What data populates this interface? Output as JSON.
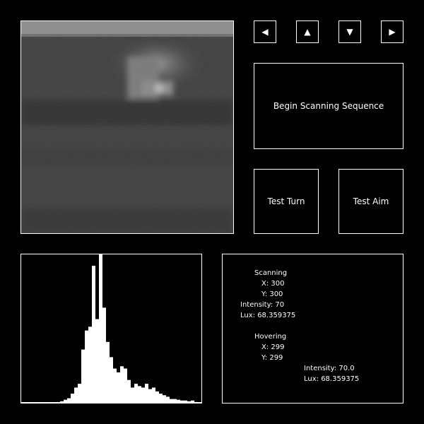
{
  "controls": {
    "left_icon": "◀",
    "up_icon": "▲",
    "down_icon": "▼",
    "right_icon": "▶",
    "scan_label": "Begin Scanning Sequence",
    "turn_label": "Test Turn",
    "aim_label": "Test Aim"
  },
  "info": {
    "scanning_title": "Scanning",
    "scanning_x": "X: 300",
    "scanning_y": "Y: 300",
    "scanning_intensity": "Intensity: 70",
    "scanning_lux": "Lux: 68.359375",
    "hovering_title": "Hovering",
    "hovering_x": "X: 299",
    "hovering_y": "Y: 299",
    "hovering_intensity": "Intensity: 70.0",
    "hovering_lux": "Lux: 68.359375"
  },
  "histogram": {
    "bins": [
      0,
      0,
      0,
      0,
      0,
      0,
      0,
      0,
      0,
      0,
      0,
      2,
      4,
      6,
      12,
      20,
      25,
      70,
      95,
      100,
      180,
      110,
      195,
      125,
      80,
      60,
      45,
      40,
      48,
      45,
      30,
      20,
      25,
      22,
      20,
      25,
      18,
      20,
      15,
      12,
      10,
      8,
      5,
      5,
      4,
      3,
      3,
      2,
      3,
      1,
      0
    ]
  },
  "colors": {
    "background": "#000000",
    "foreground": "#ffffff"
  }
}
